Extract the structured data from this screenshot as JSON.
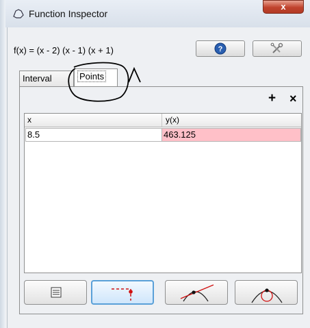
{
  "window": {
    "title": "Function Inspector",
    "close_label": "x"
  },
  "function_label": "f(x) = (x - 2) (x - 1) (x + 1)",
  "header_buttons": [
    {
      "icon": "help-icon"
    },
    {
      "icon": "tools-icon"
    }
  ],
  "tabs": [
    {
      "label": "Interval",
      "active": false
    },
    {
      "label": "Points",
      "active": true
    }
  ],
  "panel_toolbar": {
    "add_label": "+",
    "remove_label": "×"
  },
  "table": {
    "columns": [
      "x",
      "y(x)"
    ],
    "rows": [
      {
        "x": "8.5",
        "y": "463.125"
      }
    ]
  },
  "bottom_buttons": [
    {
      "icon": "table-icon",
      "selected": false
    },
    {
      "icon": "point-marker-icon",
      "selected": true
    },
    {
      "icon": "tangent-line-icon",
      "selected": false
    },
    {
      "icon": "osculating-circle-icon",
      "selected": false
    }
  ],
  "colors": {
    "y_cell_highlight": "#ffc0c8",
    "selected_border": "#5aa0d8",
    "close_button": "#c0432d"
  }
}
